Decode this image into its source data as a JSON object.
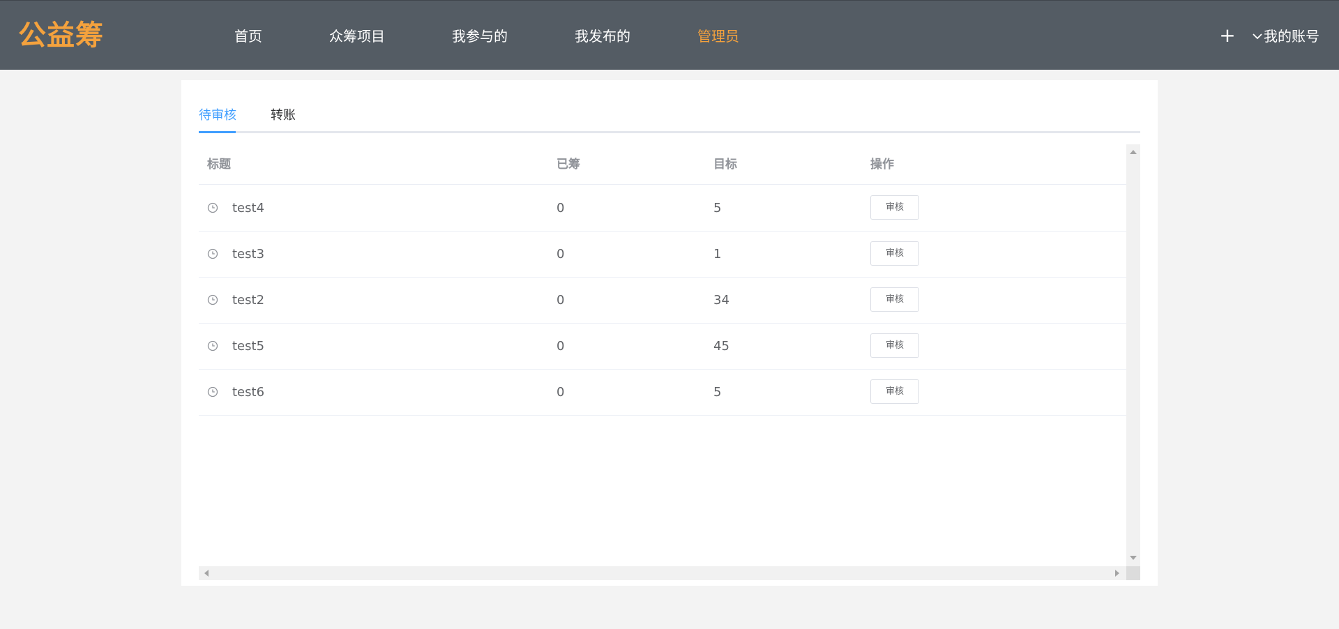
{
  "header": {
    "logo": "公益筹",
    "nav": [
      {
        "label": "首页"
      },
      {
        "label": "众筹项目"
      },
      {
        "label": "我参与的"
      },
      {
        "label": "我发布的"
      },
      {
        "label": "管理员",
        "active": true
      }
    ],
    "plus_symbol": "+",
    "account_label": "我的账号",
    "accent_color": "#f5a23d",
    "bar_color": "#545c64"
  },
  "tabs": [
    {
      "label": "待审核",
      "active": true
    },
    {
      "label": "转账"
    }
  ],
  "table": {
    "columns": [
      "标题",
      "已筹",
      "目标",
      "操作"
    ],
    "rows": [
      {
        "title": "test4",
        "raised": "0",
        "target": "5",
        "action": "审核",
        "icon": "clock-icon"
      },
      {
        "title": "test3",
        "raised": "0",
        "target": "1",
        "action": "审核",
        "icon": "clock-icon"
      },
      {
        "title": "test2",
        "raised": "0",
        "target": "34",
        "action": "审核",
        "icon": "clock-icon"
      },
      {
        "title": "test5",
        "raised": "0",
        "target": "45",
        "action": "审核",
        "icon": "clock-icon"
      },
      {
        "title": "test6",
        "raised": "0",
        "target": "5",
        "action": "审核",
        "icon": "clock-icon"
      }
    ]
  },
  "colors": {
    "tab_active": "#409eff",
    "text": "#606266",
    "header_text": "#909399"
  }
}
